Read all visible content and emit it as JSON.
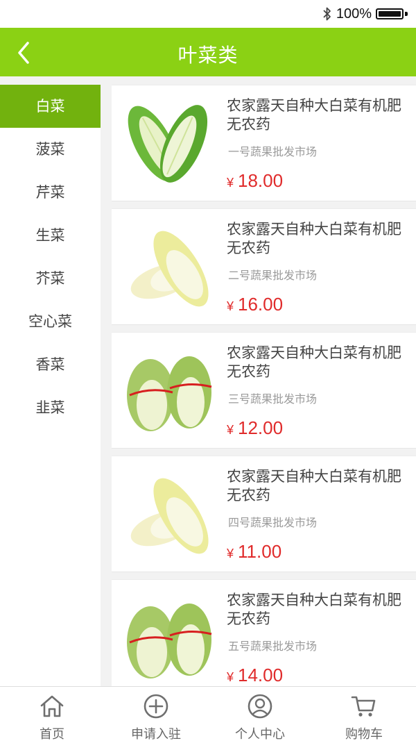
{
  "status": {
    "battery": "100%"
  },
  "header": {
    "title": "叶菜类"
  },
  "sidebar": {
    "items": [
      {
        "label": "白菜",
        "active": true
      },
      {
        "label": "菠菜"
      },
      {
        "label": "芹菜"
      },
      {
        "label": "生菜"
      },
      {
        "label": "芥菜"
      },
      {
        "label": "空心菜"
      },
      {
        "label": "香菜"
      },
      {
        "label": "韭菜"
      }
    ]
  },
  "products": [
    {
      "title": "农家露天自种大白菜有机肥无农药",
      "market": "一号蔬果批发市场",
      "currency": "¥",
      "price": "18.00",
      "image": "split-cabbage-heart"
    },
    {
      "title": "农家露天自种大白菜有机肥无农药",
      "market": "二号蔬果批发市场",
      "currency": "¥",
      "price": "16.00",
      "image": "cabbage-pair-pale"
    },
    {
      "title": "农家露天自种大白菜有机肥无农药",
      "market": "三号蔬果批发市场",
      "currency": "¥",
      "price": "12.00",
      "image": "cabbage-pair-tied"
    },
    {
      "title": "农家露天自种大白菜有机肥无农药",
      "market": "四号蔬果批发市场",
      "currency": "¥",
      "price": "11.00",
      "image": "cabbage-pair-pale"
    },
    {
      "title": "农家露天自种大白菜有机肥无农药",
      "market": "五号蔬果批发市场",
      "currency": "¥",
      "price": "14.00",
      "image": "cabbage-pair-tied"
    }
  ],
  "tabbar": {
    "items": [
      {
        "label": "首页",
        "icon": "home-icon"
      },
      {
        "label": "申请入驻",
        "icon": "plus-circle-icon"
      },
      {
        "label": "个人中心",
        "icon": "user-icon"
      },
      {
        "label": "购物车",
        "icon": "cart-icon"
      }
    ]
  },
  "colors": {
    "brand": "#8bd114",
    "active": "#72b20e",
    "price": "#e02b2b"
  }
}
